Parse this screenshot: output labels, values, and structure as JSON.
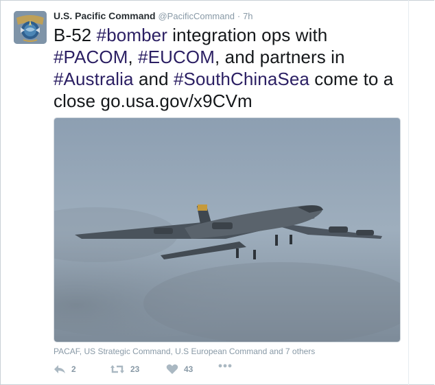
{
  "tweet": {
    "author_name": "U.S. Pacific Command",
    "author_handle": "@PacificCommand",
    "separator": "·",
    "time": "7h",
    "text": {
      "part1": "B-52 ",
      "hashtag_bomber": "#bomber",
      "part2": " integration ops with ",
      "hashtag_pacom": "#PACOM",
      "part3": ", ",
      "hashtag_eucom": "#EUCOM",
      "part4": ", and partners in ",
      "hashtag_australia": "#Australia",
      "part5": " and ",
      "hashtag_scs": "#SouthChinaSea",
      "part6": " come to a close ",
      "link": "go.usa.gov/x9CVm"
    },
    "tagged_users": "PACAF, US Strategic Command, U.S European Command and 7 others",
    "actions": {
      "reply_count": "2",
      "retweet_count": "23",
      "like_count": "43"
    }
  },
  "icons": {
    "reply": "reply-icon",
    "retweet": "retweet-icon",
    "like": "heart-icon",
    "more": "more-dots-icon"
  },
  "colors": {
    "hashtag": "#2b1f63",
    "muted": "#8899a6",
    "text": "#14171a"
  }
}
